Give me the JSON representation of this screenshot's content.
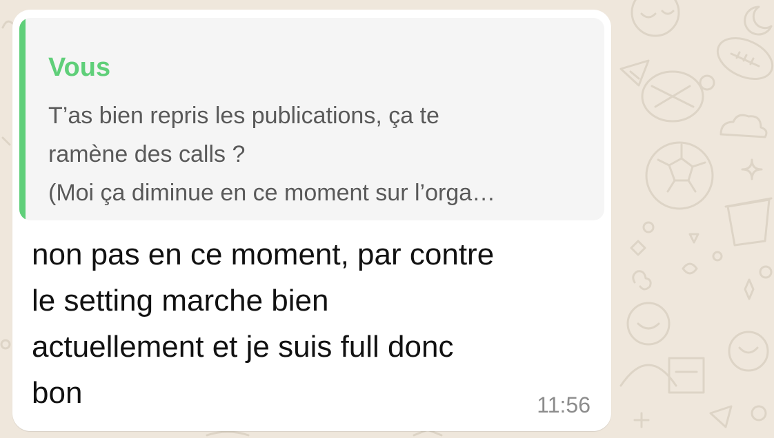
{
  "theme": {
    "wallpaper_color": "#efe7dc",
    "bubble_color": "#ffffff",
    "quote_accent": "#5fcf79"
  },
  "message": {
    "quoted": {
      "author": "Vous",
      "lines": [
        "T’as bien repris les publications, ça te",
        "ramène des calls ?",
        "(Moi ça diminue en ce moment sur l’orga…"
      ]
    },
    "body_lines": [
      "non pas en ce moment, par contre",
      "le setting marche bien",
      "actuellement et je suis full donc",
      "bon"
    ],
    "time": "11:56"
  },
  "wallpaper": {
    "doodles": [
      "cat-icon",
      "turtle-icon",
      "soccer-ball-icon",
      "football-icon",
      "flower-pot-icon",
      "person-icon",
      "paper-plane-icon",
      "cloud-icon",
      "moon-icon",
      "sparkle-icon"
    ]
  }
}
